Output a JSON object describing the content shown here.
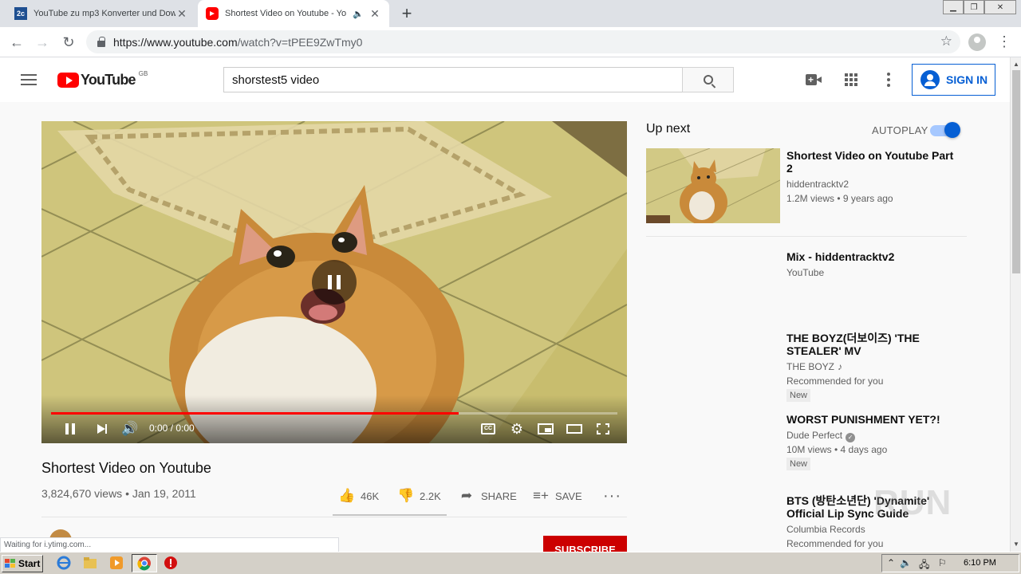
{
  "browser": {
    "tabs": [
      {
        "label": "YouTube zu mp3 Konverter und Dow",
        "favicon_text": "2c",
        "active": false
      },
      {
        "label": "Shortest Video on Youtube - Yo",
        "active": true
      }
    ],
    "url_host": "https://www.youtube.com",
    "url_path": "/watch?v=tPEE9ZwTmy0",
    "status_text": "Waiting for i.ytimg.com..."
  },
  "masthead": {
    "logo_text": "YouTube",
    "country_code": "GB",
    "search_value": "shorstest5 video",
    "sign_in_label": "SIGN IN"
  },
  "player": {
    "time": "0:00 / 0:00",
    "progress_fraction": 0.72
  },
  "video": {
    "title": "Shortest Video on Youtube",
    "views_date": "3,824,670 views • Jan 19, 2011",
    "likes": "46K",
    "dislikes": "2.2K",
    "share_label": "SHARE",
    "save_label": "SAVE",
    "subscribe_label": "SUBSCRIBE"
  },
  "sidebar": {
    "up_next_label": "Up next",
    "autoplay_label": "AUTOPLAY",
    "autoplay_on": true,
    "items": [
      {
        "title": "Shortest Video on Youtube Part 2",
        "channel": "hiddentracktv2",
        "meta": "1.2M views • 9 years ago"
      },
      {
        "title": "Mix - hiddentracktv2",
        "channel": "YouTube"
      },
      {
        "title": "THE BOYZ(더보이즈) 'THE STEALER' MV",
        "channel": "THE BOYZ",
        "meta": "Recommended for you",
        "badge": "New"
      },
      {
        "title": "WORST PUNISHMENT YET?!",
        "channel": "Dude Perfect",
        "meta": "10M views • 4 days ago",
        "badge": "New"
      },
      {
        "title": "BTS (방탄소년단) 'Dynamite' Official Lip Sync Guide",
        "channel": "Columbia Records",
        "meta": "Recommended for you"
      }
    ]
  },
  "taskbar": {
    "start_label": "Start",
    "clock": "6:10 PM"
  },
  "watermark": "RUN",
  "colors": {
    "brand_red": "#ff0000",
    "link_blue": "#065fd4",
    "subscribe_red": "#cc0000"
  }
}
